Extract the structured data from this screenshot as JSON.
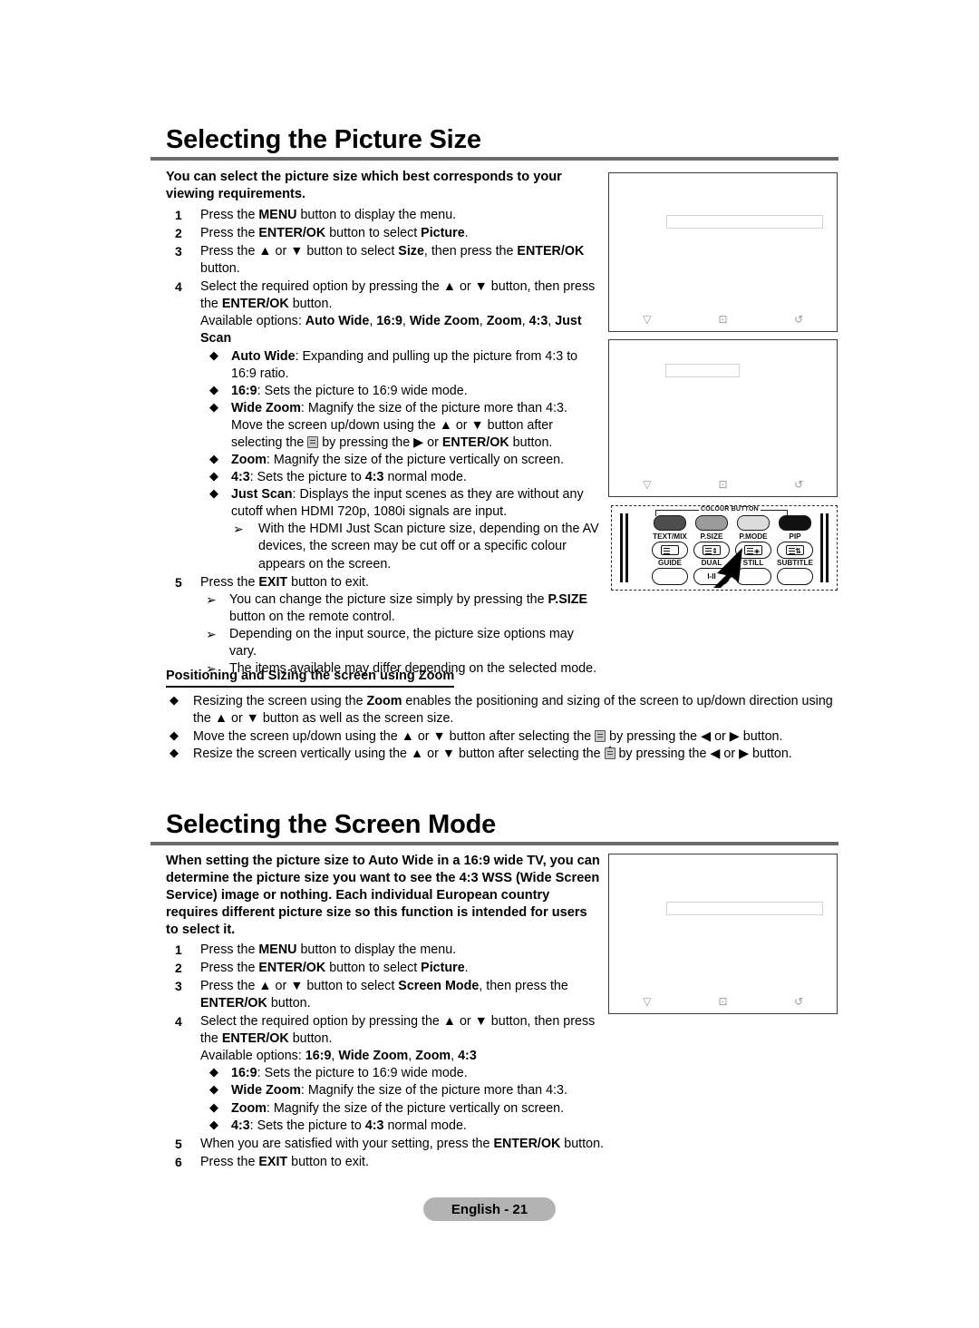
{
  "page": {
    "footer_label": "English - 21",
    "accent_rule_color": "#6b6b6b",
    "footer_bg": "#b3b3b3"
  },
  "section1": {
    "title": "Selecting the Picture Size",
    "intro": "You can select the picture size which best corresponds to your viewing requirements.",
    "steps": [
      {
        "num": "1",
        "text_html": "Press the <b>MENU</b> button to display the menu."
      },
      {
        "num": "2",
        "text_html": "Press the <b>ENTER/OK</b> button to select <b>Picture</b>."
      },
      {
        "num": "3",
        "text_html": "Press the <b>▲</b> or <b>▼</b> button to select <b>Size</b>, then press the <b>ENTER/OK</b> button."
      },
      {
        "num": "4",
        "text_html": "Select the required option by pressing the <b>▲</b> or <b>▼</b> button, then press the <b>ENTER/OK</b> button."
      }
    ],
    "available_options_html": "Available options: <b>Auto Wide</b>, <b>16:9</b>, <b>Wide Zoom</b>, <b>Zoom</b>, <b>4:3</b>, <b>Just Scan</b>",
    "option_bullets": [
      "<b>Auto Wide</b>: Expanding and pulling up the picture from 4:3 to 16:9 ratio.",
      "<b>16:9</b>: Sets the picture to 16:9 wide mode.",
      "<b>Wide Zoom</b>: Magnify the size of the picture more than 4:3. Move the screen up/down using the <b>▲</b> or <b>▼</b> button after selecting the @ICON@ by pressing the <b>▶</b> or <b>ENTER/OK</b> button.",
      "<b>Zoom</b>: Magnify the size of the picture vertically on screen.",
      "<b>4:3</b>: Sets the picture to <b>4:3</b> normal mode.",
      "<b>Just Scan</b>: Displays the input scenes as they are without any cutoff when HDMI 720p, 1080i signals are input."
    ],
    "just_scan_note": "With the HDMI Just Scan picture size, depending on the AV devices, the screen may be cut off or a specific colour appears on the screen.",
    "step5": {
      "num": "5",
      "text_html": "Press the <b>EXIT</b> button to exit."
    },
    "notes": [
      "You can change the picture size simply by pressing the <b>P.SIZE</b> button on the remote control.",
      "Depending on the input source, the picture size options may vary.",
      "The items available may differ depending on the selected mode."
    ],
    "zoom_subhead": "Positioning and Sizing the screen using Zoom",
    "zoom_bullets": [
      "Resizing the screen using the <b>Zoom</b> enables the positioning and sizing of the screen to up/down direction using the <b>▲</b> or <b>▼</b> button as well as the screen size.",
      "Move the screen up/down using the <b>▲</b> or <b>▼</b> button after selecting the @ICON@ by pressing the <b>◀</b> or <b>▶</b> button.",
      "Resize the screen vertically using the <b>▲</b> or <b>▼</b> button after selecting the @ICONV@ by pressing the <b>◀</b> or <b>▶</b> button."
    ]
  },
  "section2": {
    "title": "Selecting the Screen Mode",
    "intro": "When setting the picture size to Auto Wide in a 16:9 wide TV, you can determine the picture size you want to see the 4:3 WSS (Wide Screen Service) image or nothing. Each individual European country requires different picture size so this function is intended for users to select it.",
    "steps": [
      {
        "num": "1",
        "text_html": "Press the <b>MENU</b> button to display the menu."
      },
      {
        "num": "2",
        "text_html": "Press the <b>ENTER/OK</b> button to select <b>Picture</b>."
      },
      {
        "num": "3",
        "text_html": "Press the <b>▲</b> or <b>▼</b> button to select <b>Screen Mode</b>, then press the <b>ENTER/OK</b> button."
      },
      {
        "num": "4",
        "text_html": "Select the required option by pressing the <b>▲</b> or <b>▼</b> button, then press the <b>ENTER/OK</b> button."
      }
    ],
    "available_options_html": "Available options: <b>16:9</b>, <b>Wide Zoom</b>, <b>Zoom</b>, <b>4:3</b>",
    "option_bullets": [
      "<b>16:9</b>: Sets the picture to 16:9 wide mode.",
      "<b>Wide Zoom</b>: Magnify the size of the picture more than 4:3.",
      "<b>Zoom</b>: Magnify the size of the picture vertically on screen.",
      "<b>4:3</b>: Sets the picture to <b>4:3</b> normal mode."
    ],
    "steps_tail": [
      {
        "num": "5",
        "text_html": "When you are satisfied with your setting, press the <b>ENTER/OK</b> button."
      },
      {
        "num": "6",
        "text_html": "Press the <b>EXIT</b> button to exit."
      }
    ]
  },
  "illustrations": {
    "osd_icons": [
      "▽",
      "⊡",
      "↺"
    ],
    "screens": [
      {
        "name": "picture-size-menu-screen"
      },
      {
        "name": "size-submenu-screen"
      },
      {
        "name": "screen-mode-menu-screen"
      }
    ]
  },
  "remote": {
    "colour_button_label": "COLOUR BUTTON",
    "colour_keys": [
      {
        "label": "TEXT/MIX",
        "color": "#4d4d4d"
      },
      {
        "label": "P.SIZE",
        "color": "#9b9b9b"
      },
      {
        "label": "P.MODE",
        "color": "#dcdcdc"
      },
      {
        "label": "PIP",
        "color": "#111111"
      }
    ],
    "lower_labels": [
      "GUIDE",
      "DUAL",
      "STILL",
      "SUBTITLE"
    ],
    "dual_key_label": "I-II"
  }
}
